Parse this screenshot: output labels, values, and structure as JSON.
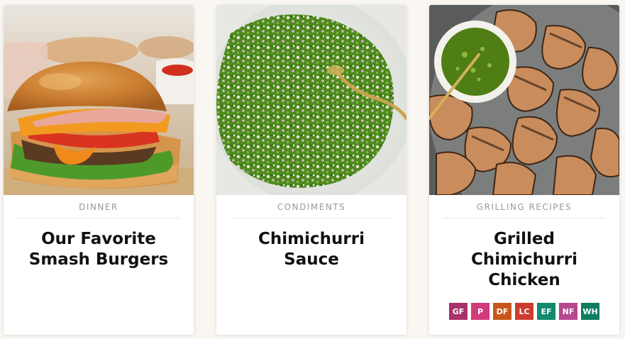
{
  "cards": [
    {
      "category": "DINNER",
      "title_line1": "Our Favorite",
      "title_line2": "Smash Burgers",
      "image_subject": "smash burger with cheese, tomato, lettuce and pink sauce"
    },
    {
      "category": "CONDIMENTS",
      "title_line1": "Chimichurri",
      "title_line2": "Sauce",
      "image_subject": "bowl of chimichurri sauce with spoon"
    },
    {
      "category": "GRILLING RECIPES",
      "title_line1": "Grilled",
      "title_line2": "Chimichurri",
      "title_line3": "Chicken",
      "image_subject": "grilled chicken with chimichurri dip",
      "badges": [
        {
          "label": "GF",
          "color": "#a8326b"
        },
        {
          "label": "P",
          "color": "#d13a7b"
        },
        {
          "label": "DF",
          "color": "#c8561a"
        },
        {
          "label": "LC",
          "color": "#cc3d2e"
        },
        {
          "label": "EF",
          "color": "#138a6e"
        },
        {
          "label": "NF",
          "color": "#b5488f"
        },
        {
          "label": "WH",
          "color": "#0f7d5f"
        }
      ]
    }
  ]
}
